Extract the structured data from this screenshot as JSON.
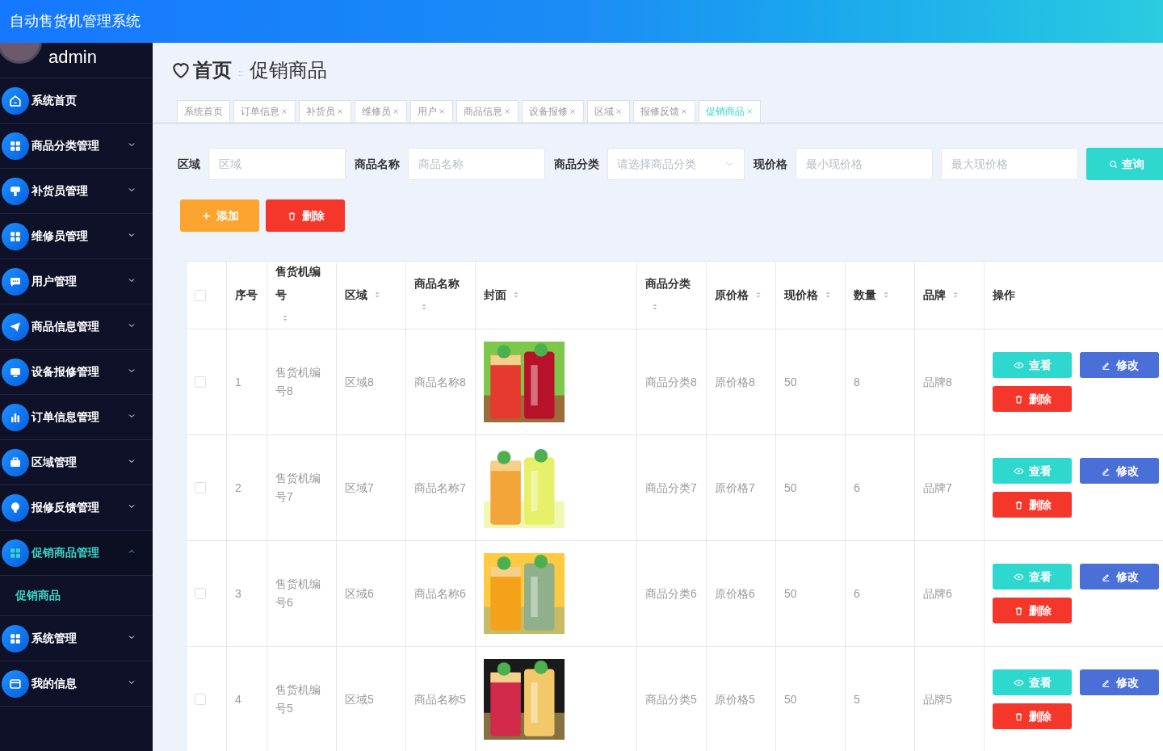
{
  "app_title": "自动售货机管理系统",
  "user": {
    "name": "admin"
  },
  "sidebar": {
    "items": [
      {
        "label": "系统首页",
        "expandable": false,
        "selected": false
      },
      {
        "label": "商品分类管理",
        "expandable": true,
        "expanded": false,
        "selected": false
      },
      {
        "label": "补货员管理",
        "expandable": true,
        "expanded": false,
        "selected": false
      },
      {
        "label": "维修员管理",
        "expandable": true,
        "expanded": false,
        "selected": false
      },
      {
        "label": "用户管理",
        "expandable": true,
        "expanded": false,
        "selected": false
      },
      {
        "label": "商品信息管理",
        "expandable": true,
        "expanded": false,
        "selected": false
      },
      {
        "label": "设备报修管理",
        "expandable": true,
        "expanded": false,
        "selected": false
      },
      {
        "label": "订单信息管理",
        "expandable": true,
        "expanded": false,
        "selected": false
      },
      {
        "label": "区域管理",
        "expandable": true,
        "expanded": false,
        "selected": false
      },
      {
        "label": "报修反馈管理",
        "expandable": true,
        "expanded": false,
        "selected": false
      },
      {
        "label": "促销商品管理",
        "expandable": true,
        "expanded": true,
        "selected": true,
        "children": [
          {
            "label": "促销商品",
            "selected": true
          }
        ]
      },
      {
        "label": "系统管理",
        "expandable": true,
        "expanded": false,
        "selected": false
      },
      {
        "label": "我的信息",
        "expandable": true,
        "expanded": false,
        "selected": false
      }
    ]
  },
  "breadcrumb": {
    "home": "首页",
    "separator": "::",
    "current": "促销商品"
  },
  "tabs": [
    {
      "label": "系统首页",
      "closable": false,
      "selected": false
    },
    {
      "label": "订单信息",
      "closable": true,
      "selected": false
    },
    {
      "label": "补货员",
      "closable": true,
      "selected": false
    },
    {
      "label": "维修员",
      "closable": true,
      "selected": false
    },
    {
      "label": "用户",
      "closable": true,
      "selected": false
    },
    {
      "label": "商品信息",
      "closable": true,
      "selected": false
    },
    {
      "label": "设备报修",
      "closable": true,
      "selected": false
    },
    {
      "label": "区域",
      "closable": true,
      "selected": false
    },
    {
      "label": "报修反馈",
      "closable": true,
      "selected": false
    },
    {
      "label": "促销商品",
      "closable": true,
      "selected": true
    }
  ],
  "filters": [
    {
      "kind": "text",
      "label": "区域",
      "placeholder": "区域"
    },
    {
      "kind": "text",
      "label": "商品名称",
      "placeholder": "商品名称"
    },
    {
      "kind": "select",
      "label": "商品分类",
      "placeholder": "请选择商品分类"
    },
    {
      "kind": "text",
      "label": "现价格",
      "placeholder": "最小现价格"
    },
    {
      "kind": "text",
      "placeholder": "最大现价格"
    }
  ],
  "search_button": "查询",
  "toolbar": [
    {
      "kind": "add",
      "label": "添加"
    },
    {
      "kind": "delete",
      "label": "删除"
    }
  ],
  "table": {
    "columns": [
      {
        "kind": "check",
        "checked": false
      },
      {
        "label": "序号",
        "sortable": false
      },
      {
        "label": "售货机编号",
        "sortable": true
      },
      {
        "label": "区域",
        "sortable": true
      },
      {
        "label": "商品名称",
        "sortable": true
      },
      {
        "label": "封面",
        "sortable": true
      },
      {
        "label": "商品分类",
        "sortable": true
      },
      {
        "label": "原价格",
        "sortable": true
      },
      {
        "label": "现价格",
        "sortable": true
      },
      {
        "label": "数量",
        "sortable": true
      },
      {
        "label": "品牌",
        "sortable": true
      },
      {
        "label": "操作",
        "sortable": false
      }
    ],
    "rows": [
      {
        "checked": false,
        "index": "1",
        "machine": "售货机编号8",
        "area": "区域8",
        "name": "商品名称8",
        "cover": {
          "kind": "picture"
        },
        "category": "商品分类8",
        "original_price": "原价格8",
        "price": "50",
        "quantity": "8",
        "brand": "品牌8",
        "actions": [
          {
            "kind": "view",
            "label": "查看"
          },
          {
            "kind": "edit",
            "label": "修改"
          },
          {
            "kind": "delete",
            "label": "删除"
          }
        ]
      },
      {
        "checked": false,
        "index": "2",
        "machine": "售货机编号7",
        "area": "区域7",
        "name": "商品名称7",
        "cover": {
          "kind": "picture"
        },
        "category": "商品分类7",
        "original_price": "原价格7",
        "price": "50",
        "quantity": "6",
        "brand": "品牌7",
        "actions": [
          {
            "kind": "view",
            "label": "查看"
          },
          {
            "kind": "edit",
            "label": "修改"
          },
          {
            "kind": "delete",
            "label": "删除"
          }
        ]
      },
      {
        "checked": false,
        "index": "3",
        "machine": "售货机编号6",
        "area": "区域6",
        "name": "商品名称6",
        "cover": {
          "kind": "picture"
        },
        "category": "商品分类6",
        "original_price": "原价格6",
        "price": "50",
        "quantity": "6",
        "brand": "品牌6",
        "actions": [
          {
            "kind": "view",
            "label": "查看"
          },
          {
            "kind": "edit",
            "label": "修改"
          },
          {
            "kind": "delete",
            "label": "删除"
          }
        ]
      },
      {
        "checked": false,
        "index": "4",
        "machine": "售货机编号5",
        "area": "区域5",
        "name": "商品名称5",
        "cover": {
          "kind": "picture"
        },
        "category": "商品分类5",
        "original_price": "原价格5",
        "price": "50",
        "quantity": "5",
        "brand": "品牌5",
        "actions": [
          {
            "kind": "view",
            "label": "查看"
          },
          {
            "kind": "edit",
            "label": "修改"
          },
          {
            "kind": "delete",
            "label": "删除"
          }
        ]
      }
    ]
  }
}
